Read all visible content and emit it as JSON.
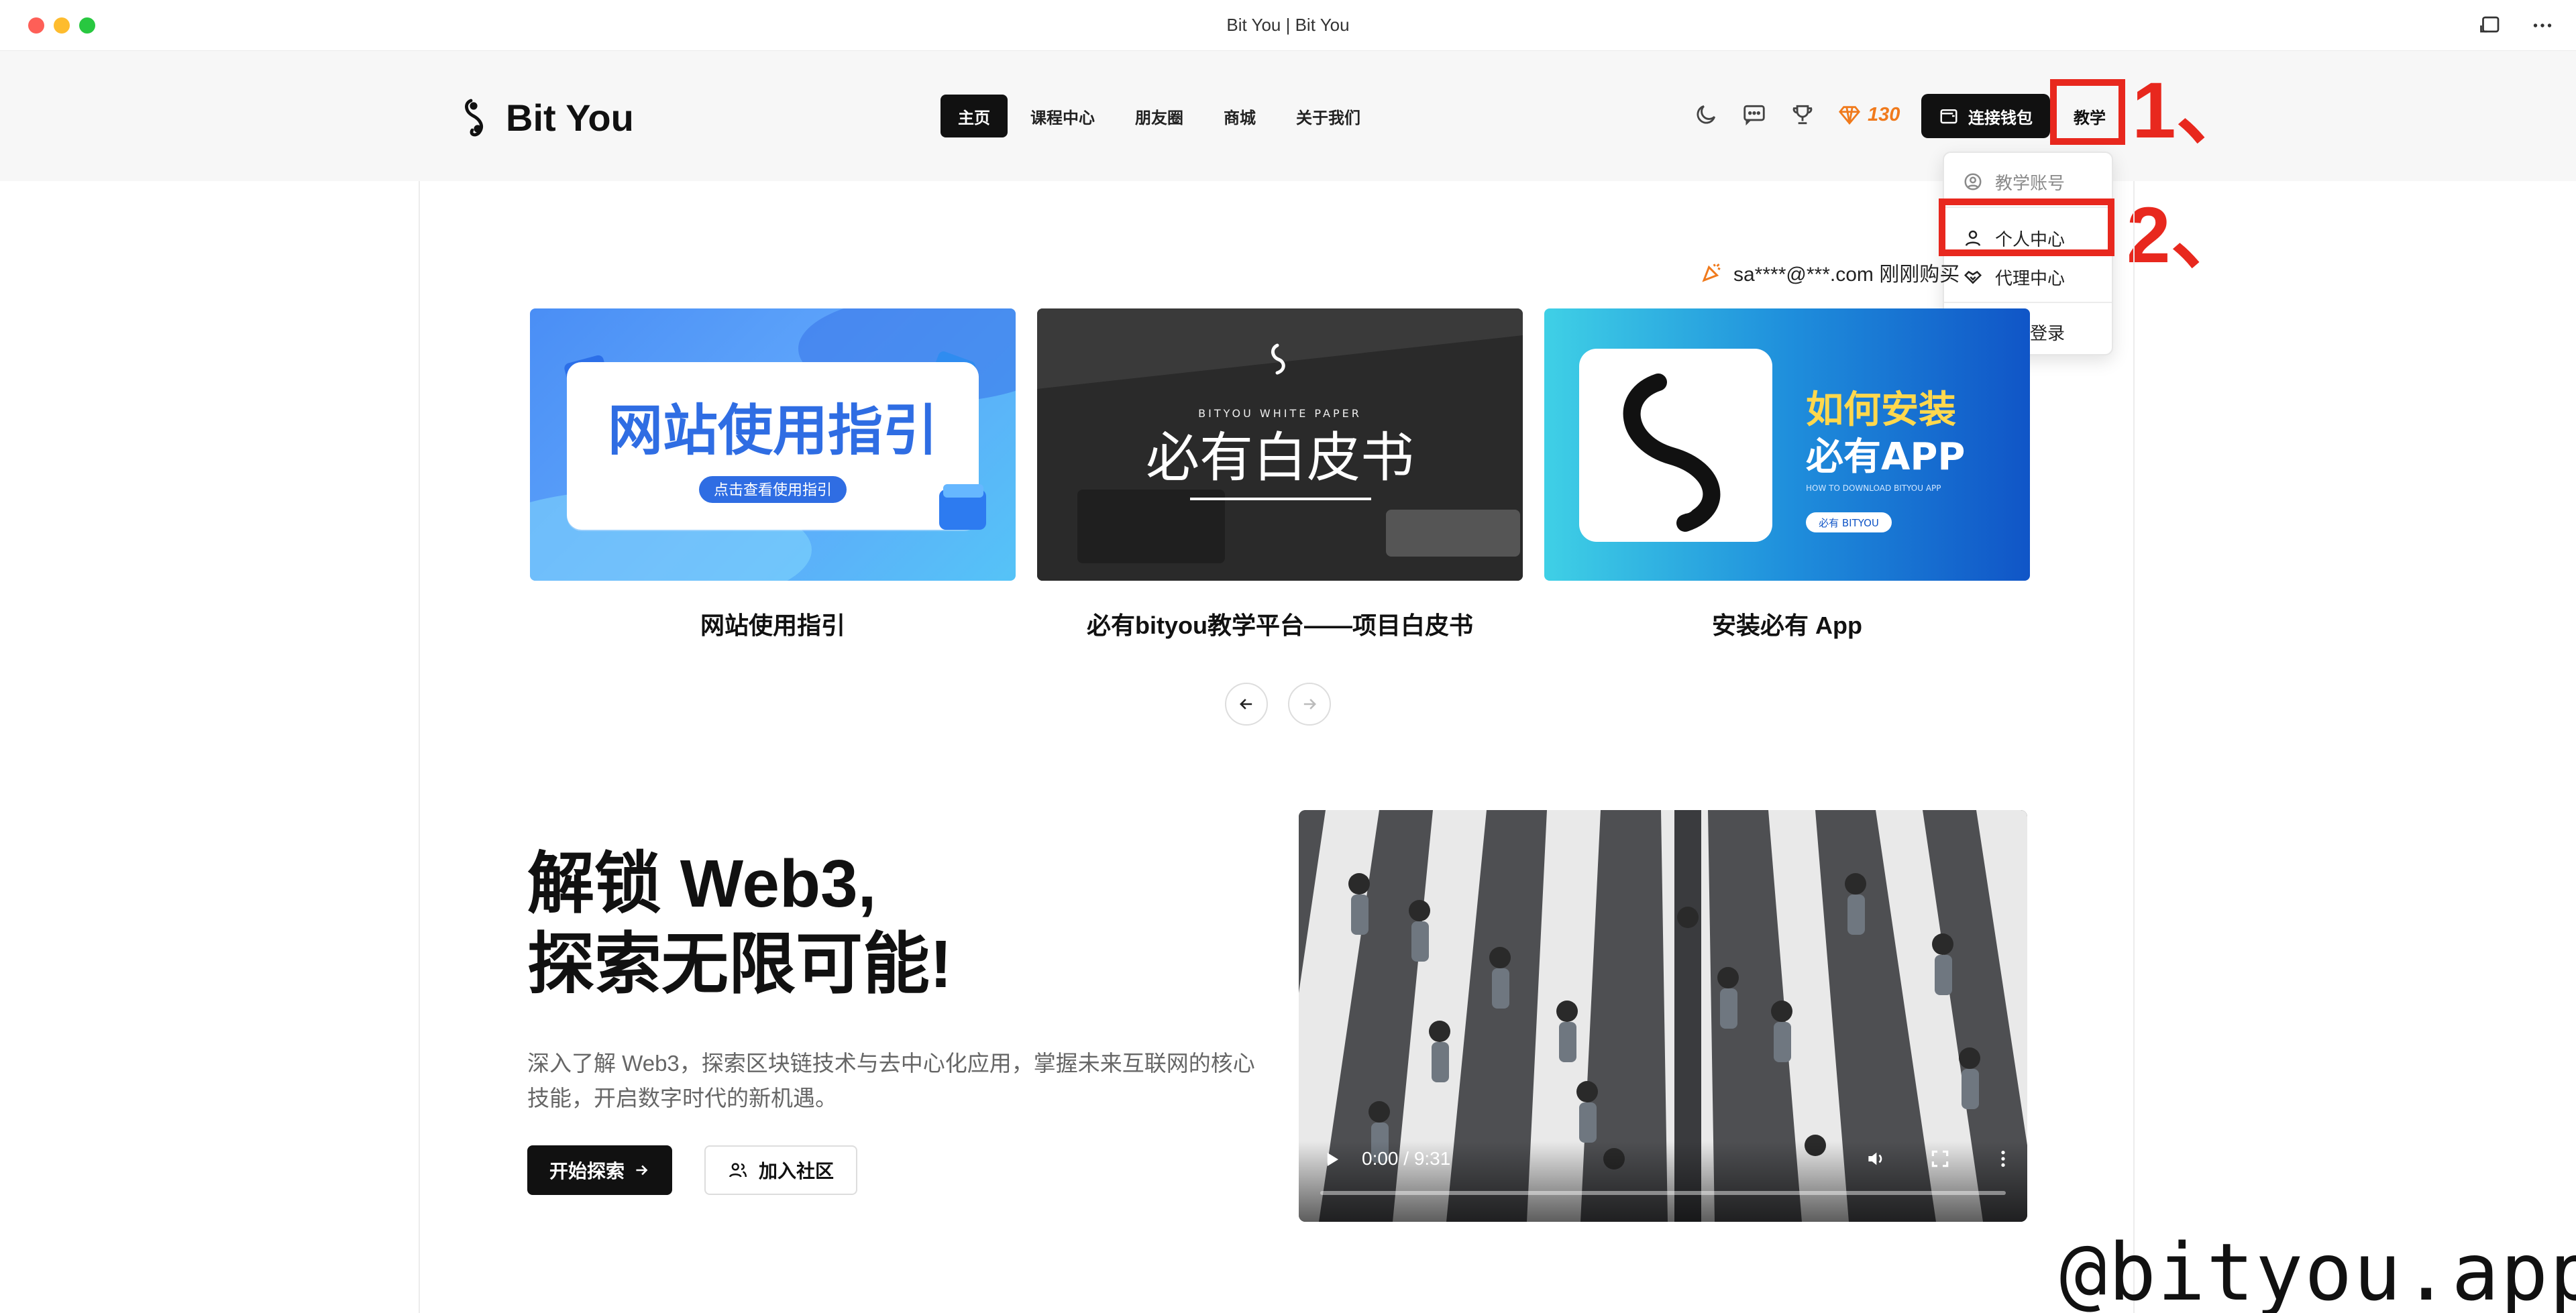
{
  "window": {
    "title": "Bit You | Bit You"
  },
  "header": {
    "logo_text": "Bit You",
    "nav": [
      "主页",
      "课程中心",
      "朋友圈",
      "商城",
      "关于我们"
    ],
    "points": "130",
    "wallet_label": "连接钱包",
    "teach_label": "教学"
  },
  "annotations": {
    "step1": "1、",
    "step2": "2、"
  },
  "dropdown": {
    "items": [
      {
        "label": "教学账号",
        "icon": "user-circle-icon"
      },
      {
        "label": "个人中心",
        "icon": "user-icon"
      },
      {
        "label": "代理中心",
        "icon": "handshake-icon"
      },
      {
        "label": "退出登录",
        "icon": "logout-icon"
      }
    ]
  },
  "notice": {
    "text": "sa****@***.com 刚刚购买"
  },
  "carousel": {
    "cards": [
      {
        "caption": "网站使用指引",
        "art_title": "网站使用指引",
        "art_sub": "点击查看使用指引"
      },
      {
        "caption": "必有bityou教学平台——项目白皮书",
        "art_small": "BITYOU WHITE PAPER",
        "art_title": "必有白皮书"
      },
      {
        "caption": "安装必有 App",
        "art_title1": "如何安装",
        "art_title2": "必有APP",
        "art_small": "HOW TO DOWNLOAD BITYOU APP",
        "art_tag": "必有 BITYOU"
      }
    ]
  },
  "hero": {
    "title_line1": "解锁 Web3,",
    "title_line2": "探索无限可能!",
    "description": "深入了解 Web3，探索区块链技术与去中心化应用，掌握未来互联网的核心技能，开启数字时代的新机遇。",
    "primary_button": "开始探索",
    "secondary_button": "加入社区"
  },
  "video": {
    "time": "0:00 / 9:31"
  },
  "watermark": "@bityou.app",
  "colors": {
    "accent_red": "#e8281e",
    "points_orange": "#f07a1c",
    "dark": "#111111"
  }
}
